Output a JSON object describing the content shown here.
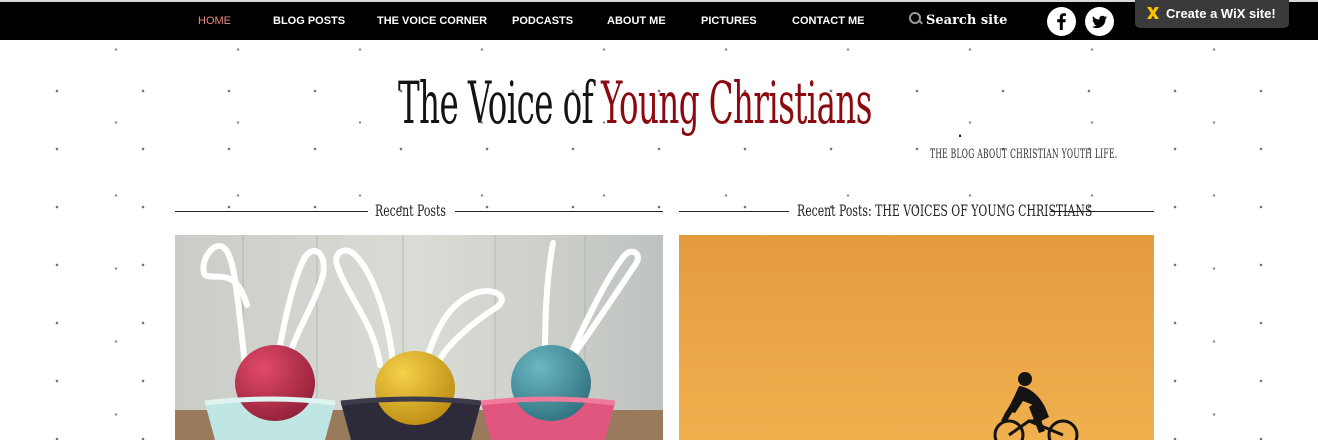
{
  "nav": {
    "items": [
      {
        "label": "HOME",
        "active": true
      },
      {
        "label": "BLOG POSTS",
        "active": false
      },
      {
        "label": "THE VOICE CORNER",
        "active": false
      },
      {
        "label": "PODCASTS",
        "active": false
      },
      {
        "label": "ABOUT ME",
        "active": false
      },
      {
        "label": "PICTURES",
        "active": false
      },
      {
        "label": "CONTACT ME",
        "active": false
      }
    ],
    "search_label": "Search site",
    "social": [
      {
        "icon": "facebook-icon"
      },
      {
        "icon": "twitter-icon"
      }
    ],
    "wix_label": "Create a WiX  site!"
  },
  "header": {
    "title_part1": "The Voice of",
    "title_part2": "Young Christians",
    "title_dot": ".",
    "tagline": "THE BLOG ABOUT CHRISTIAN YOUTH LIFE."
  },
  "sections": {
    "left_title": "Recent Posts",
    "right_title": "Recent Posts: THE VOICES OF YOUNG CHRISTIANS"
  },
  "images": {
    "left": "easter-eggs-bunny-ears-photo",
    "right": "cyclist-sunset-photo"
  },
  "colors": {
    "nav_bg": "#000000",
    "nav_active": "#e58a80",
    "title_accent": "#8b0a10",
    "sunset": "#e8a140"
  }
}
